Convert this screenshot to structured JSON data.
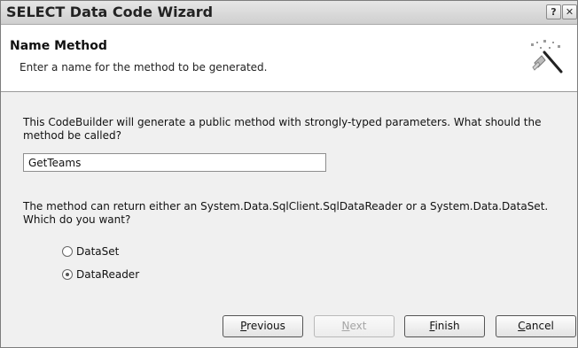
{
  "window": {
    "title": "SELECT Data Code Wizard",
    "help_glyph": "?",
    "close_glyph": "✕"
  },
  "header": {
    "title": "Name Method",
    "subtitle": "Enter a name for the method to be generated."
  },
  "content": {
    "question": "This CodeBuilder will generate a public method with strongly-typed parameters.  What should the method be called?",
    "method_name_value": "GetTeams",
    "return_question": "The method can return either an System.Data.SqlClient.SqlDataReader or a System.Data.DataSet.  Which do you want?",
    "options": [
      {
        "label": "DataSet",
        "selected": false
      },
      {
        "label": "DataReader",
        "selected": true
      }
    ]
  },
  "buttons": {
    "previous": {
      "mnemonic": "P",
      "rest": "revious",
      "enabled": true
    },
    "next": {
      "mnemonic": "N",
      "rest": "ext",
      "enabled": false
    },
    "finish": {
      "mnemonic": "F",
      "rest": "inish",
      "enabled": true
    },
    "cancel": {
      "mnemonic": "C",
      "rest": "ancel",
      "enabled": true
    }
  },
  "icons": {
    "header_icon": "wand-icon",
    "help": "help-icon",
    "close": "close-icon"
  }
}
